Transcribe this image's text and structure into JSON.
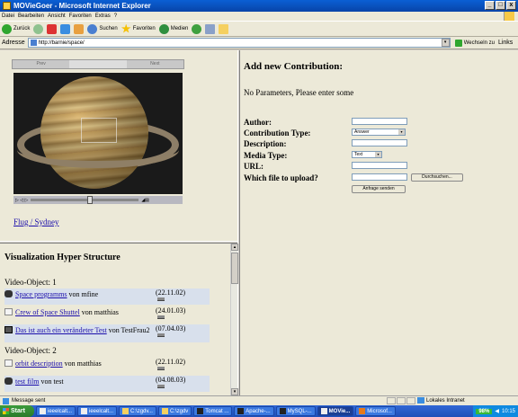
{
  "window": {
    "title": "MOVieGoer - Microsoft Internet Explorer",
    "btn_min": "_",
    "btn_max": "□",
    "btn_close": "x"
  },
  "menu": [
    "Datei",
    "Bearbeiten",
    "Ansicht",
    "Favoriten",
    "Extras",
    "?"
  ],
  "toolbar": {
    "back": "Zurück",
    "search": "Suchen",
    "favorites": "Favoriten",
    "media": "Medien"
  },
  "address": {
    "label": "Adresse",
    "url": "http://barnie/space/",
    "go": "Wechseln zu",
    "links": "Links"
  },
  "player": {
    "tab_left": "Prev",
    "tab_right": "Next",
    "controls": "▷ ◁ ▷"
  },
  "flug_link": "Flug / Sydney",
  "vhs": {
    "title": "Visualization Hyper Structure",
    "groups": [
      {
        "heading": "Video-Object: 1",
        "entries": [
          {
            "link": "Space programms",
            "author": " von mfine",
            "date": "(22.11.02)"
          },
          {
            "link": "Crew of Space Shuttel",
            "author": " von matthias",
            "date": "(24.01.03)"
          },
          {
            "link": "Das ist auch ein verändeter Test",
            "author": " von TestFrau2",
            "date": "(07.04.03)"
          }
        ]
      },
      {
        "heading": "Video-Object: 2",
        "entries": [
          {
            "link": "orbit description",
            "author": " von matthias",
            "date": "(22.11.02)"
          },
          {
            "link": "test film",
            "author": " von test",
            "date": "(04.08.03)"
          }
        ]
      }
    ]
  },
  "form": {
    "title": "Add new Contribution:",
    "message": "No Parameters, Please enter some",
    "author_label": "Author:",
    "type_label": "Contribution Type:",
    "type_value": "Answer",
    "desc_label": "Description:",
    "media_label": "Media Type:",
    "media_value": "Text",
    "url_label": "URL:",
    "file_label": "Which file to upload?",
    "browse": "Durchsuchen...",
    "submit": "Anfrage senden"
  },
  "status": {
    "text": "Message sent",
    "zone": "Lokales Intranet"
  },
  "taskbar": {
    "start": "Start",
    "tasks": [
      "ieeelcalt...",
      "ieeelcalt...",
      "C:\\zgdv...",
      "C:\\zgdv",
      "Tomcat ...",
      "Apache-...",
      "MySQL-...",
      "MOVie...",
      "Microsof..."
    ],
    "battery": "98%",
    "clock": "10:15"
  }
}
